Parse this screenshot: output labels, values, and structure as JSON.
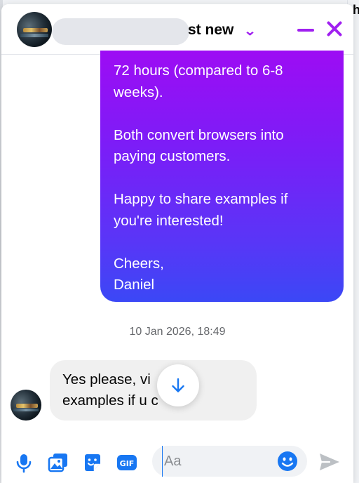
{
  "header": {
    "title_visible": "st new",
    "chevron_glyph": "⌄"
  },
  "sent_message": {
    "paragraphs": [
      "72 hours (compared to 6-8\nweeks).",
      "Both convert browsers into\npaying customers.",
      "Happy to share examples if\nyou're interested!",
      "Cheers,\nDaniel"
    ]
  },
  "timestamp": "10 Jan 2026, 18:49",
  "received_message": {
    "text": "Yes please, vi\nexamples if u c"
  },
  "composer": {
    "placeholder": "Aa"
  },
  "background": {
    "right_letter": "h"
  },
  "colors": {
    "accent": "#a020f0",
    "bubble_top": "#9d0cf4",
    "bubble_bottom": "#3b48f6",
    "icon_blue": "#1877f2"
  },
  "icons": [
    "mic-icon",
    "photo-icon",
    "sticker-icon",
    "gif-icon",
    "emoji-icon",
    "send-icon",
    "arrow-down-icon",
    "minimize-icon",
    "close-icon",
    "chevron-down-icon"
  ]
}
